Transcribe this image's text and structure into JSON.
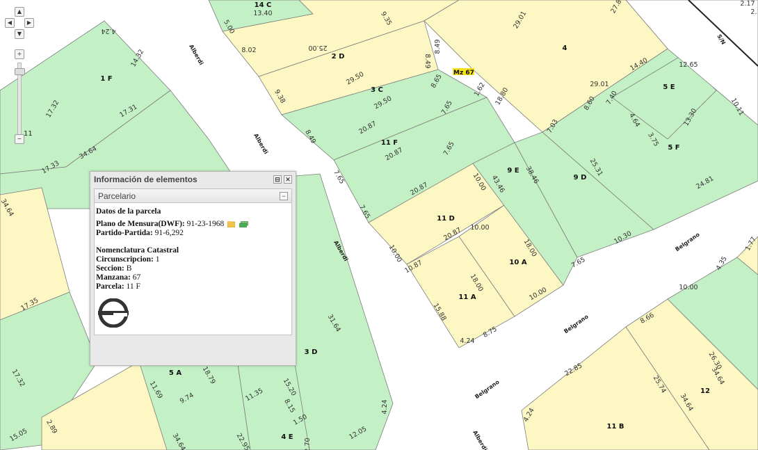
{
  "map": {
    "streets": [
      "Alberdi",
      "Alberdi",
      "Alberdi",
      "Alberdi",
      "Belgrano",
      "Belgrano",
      "Belgrano",
      "S/N"
    ],
    "block_label": "Mz 67",
    "parcels": [
      "14 C",
      "2 D",
      "3 C",
      "4",
      "5 E",
      "5 F",
      "9 D",
      "9 E",
      "11 F",
      "11 D",
      "10 A",
      "11 A",
      "1 F",
      "3 D",
      "5 A",
      "4 E",
      "12",
      "11 B"
    ],
    "measures": [
      "13.40",
      "5.00",
      "9.35",
      "25.00",
      "8.02",
      "29.01",
      "27.86",
      "2.17",
      "2.15",
      "8.49",
      "8.49",
      "9.38",
      "29.50",
      "29.50",
      "8.65",
      "18.80",
      "29.01",
      "14.40",
      "12.65",
      "1.62",
      "4.24",
      "14.32",
      "17.31",
      "17.32",
      "34.64",
      "17.33",
      "7.65",
      "7.65",
      "8.49",
      "20.87",
      "20.87",
      "7.65",
      "7.65",
      "20.87",
      "20.87",
      "10.00",
      "10.00",
      "10.00",
      "18.00",
      "18.00",
      "10.87",
      "15.88",
      "8.75",
      "10.00",
      "4.24",
      "43.46",
      "38.46",
      "25.31",
      "10.30",
      "24.81",
      "7.65",
      "7.40",
      "8.60",
      "4.64",
      "3.75",
      "13.30",
      "10.11",
      "7.03",
      "34.64",
      "17.35",
      "31.64",
      "17.32",
      "11.69",
      "9.74",
      "18.79",
      "11.35",
      "15.20",
      "8.15",
      "1.50",
      "12.05",
      "4.24",
      "15.05",
      "2.89",
      "22.95",
      "34.64",
      "2.70",
      "4.35",
      "10.00",
      "8.66",
      "26.30",
      "34.64",
      "22.85",
      "25.74",
      "34.64",
      "4.24",
      "1.77"
    ]
  },
  "nav": {
    "up": "▲",
    "left": "◀",
    "right": "▶",
    "down": "▼",
    "zoom_in": "+",
    "zoom_out": "−",
    "zoom_level": "11",
    "zoom_fraction": 0.08
  },
  "panel": {
    "title": "Información de elementos",
    "subtitle": "Parcelario",
    "section1": "Datos de la parcela",
    "plano_label": "Plano de Mensura(DWF):",
    "plano_value": "91-23-1968",
    "partido_label": "Partido-Partida:",
    "partido_value": "91-6,292",
    "section2": "Nomenclatura Catastral",
    "circ_label": "Circunscripcion:",
    "circ_value": "1",
    "secc_label": "Seccion:",
    "secc_value": "B",
    "manz_label": "Manzana:",
    "manz_value": "67",
    "parc_label": "Parcela:",
    "parc_value": "11 F",
    "pin_icon": "pin-icon",
    "close_icon": "close-icon",
    "collapse_icon": "collapse-icon"
  },
  "colors": {
    "green": "#c3f0c5",
    "yellow": "#fdf7c3",
    "street": "#ffffff",
    "line": "#7d7d7d",
    "highlight": "#f4e21a"
  }
}
